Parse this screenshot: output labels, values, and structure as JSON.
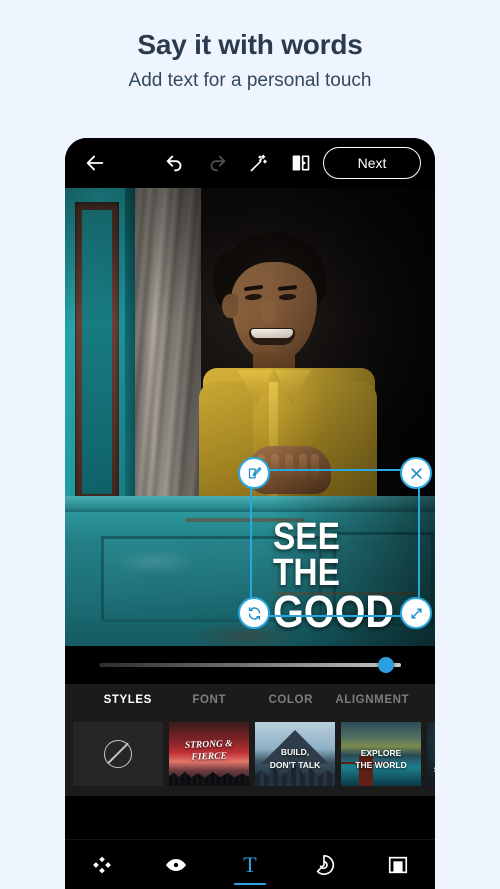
{
  "promo": {
    "title": "Say it with words",
    "subtitle": "Add text for a personal touch"
  },
  "toolbar": {
    "back_icon": "back-arrow-icon",
    "undo_icon": "undo-icon",
    "redo_icon": "redo-icon",
    "magic_icon": "magic-wand-icon",
    "compare_icon": "compare-split-icon",
    "next_label": "Next"
  },
  "canvas": {
    "overlay_text_line1": "SEE THE",
    "overlay_text_line2": "GOOD",
    "handles": {
      "edit": "edit-text-handle",
      "close": "delete-text-handle",
      "rotate": "rotate-text-handle",
      "resize": "resize-text-handle"
    }
  },
  "slider": {
    "name": "opacity-slider",
    "value_percent": 95
  },
  "tabs": [
    {
      "label": "STYLES",
      "active": true
    },
    {
      "label": "FONT",
      "active": false
    },
    {
      "label": "COLOR",
      "active": false
    },
    {
      "label": "ALIGNMENT",
      "active": false
    }
  ],
  "thumbnails": [
    {
      "id": "none",
      "label": "",
      "selected": false
    },
    {
      "id": "strong-fierce",
      "label": "STRONG &\nFIERCE",
      "selected": false
    },
    {
      "id": "build-dont-talk",
      "label_line1": "BUILD,",
      "label_line2": "DON'T TALK",
      "selected": true
    },
    {
      "id": "explore-the-world",
      "label_line1": "EXPLORE",
      "label_line2": "THE WORLD",
      "selected": false
    },
    {
      "id": "make-it-simple",
      "label": "MAKE IT SIM\nSIGNIFIC",
      "selected": false
    }
  ],
  "bottom_nav": [
    {
      "id": "heal",
      "icon": "heal-patch-icon",
      "active": false
    },
    {
      "id": "looks",
      "icon": "eye-icon",
      "active": false
    },
    {
      "id": "text",
      "icon": "text-t-icon",
      "label": "T",
      "active": true
    },
    {
      "id": "stickers",
      "icon": "sticker-decal-icon",
      "active": false
    },
    {
      "id": "frames",
      "icon": "frame-icon",
      "active": false
    }
  ],
  "colors": {
    "page_background": "#eff5ff",
    "accent_blue": "#2b9fe0",
    "selection_blue": "#29a8e0",
    "panel_background": "#1b1b1b",
    "phone_background": "#000000",
    "heading_text": "#2b3b4e"
  }
}
